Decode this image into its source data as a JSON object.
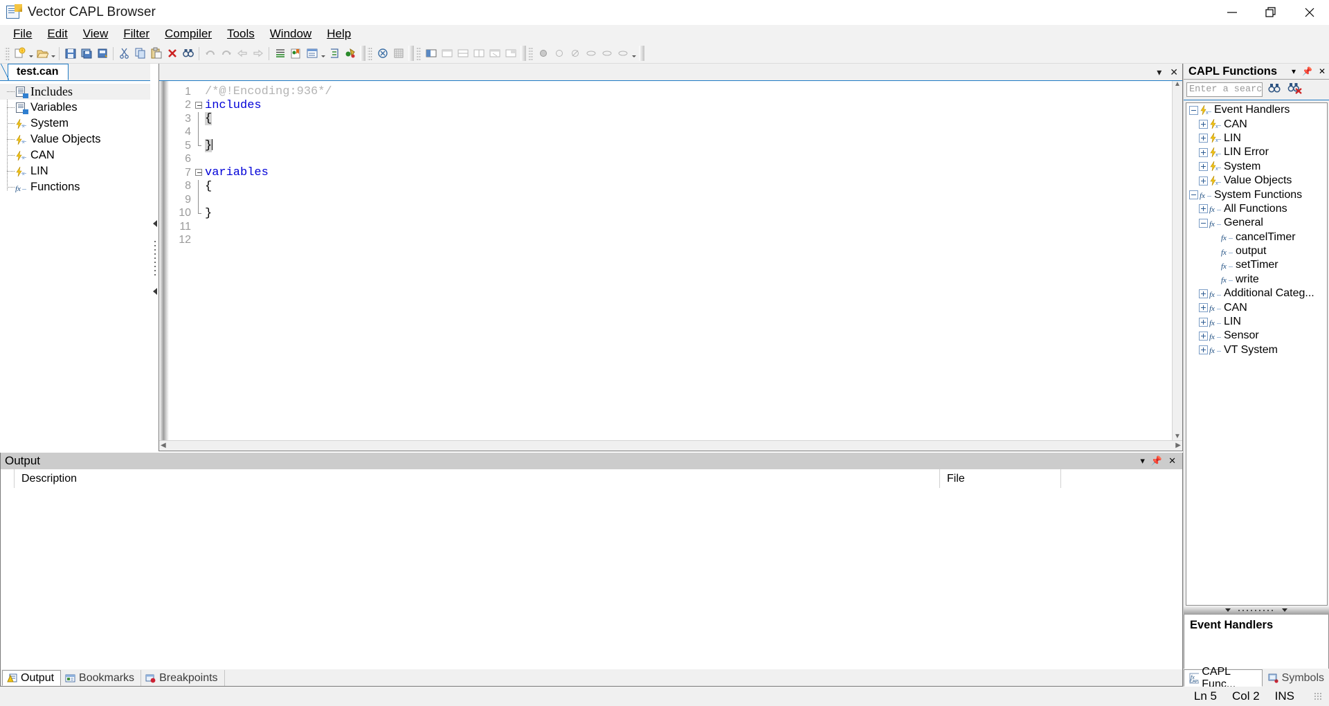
{
  "window": {
    "title": "Vector CAPL Browser",
    "icon": "capl-document-icon",
    "controls": {
      "minimize": "—",
      "restore": "❐",
      "close": "✕"
    }
  },
  "menubar": {
    "items": [
      {
        "label": "File",
        "accel": "F"
      },
      {
        "label": "Edit",
        "accel": "E"
      },
      {
        "label": "View",
        "accel": "V"
      },
      {
        "label": "Filter",
        "accel": "i"
      },
      {
        "label": "Compiler",
        "accel": "C"
      },
      {
        "label": "Tools",
        "accel": "T"
      },
      {
        "label": "Window",
        "accel": "W"
      },
      {
        "label": "Help",
        "accel": "H"
      }
    ]
  },
  "toolbar": {
    "groups": [
      {
        "buttons": [
          "new-file-icon",
          "dropdown-arrow",
          "open-file-icon",
          "dropdown-arrow"
        ]
      },
      {
        "buttons": [
          "save-icon",
          "save-all-icon",
          "save-copy-icon"
        ]
      },
      {
        "buttons": [
          "cut-icon",
          "copy-icon",
          "paste-icon",
          "delete-icon",
          "find-icon"
        ]
      },
      {
        "buttons": [
          "undo-icon",
          "redo-icon",
          "navigate-back-icon",
          "navigate-forward-icon"
        ]
      },
      {
        "buttons": [
          "indent-icon",
          "bookmark-icon",
          "comment-icon",
          "dropdown-arrow",
          "uncomment-icon",
          "compile-icon"
        ]
      },
      {
        "buttons": [
          "build-icon",
          "debug-icon"
        ]
      },
      {
        "buttons": [
          "window-tile-icon",
          "window-cascade-icon",
          "window-h-icon",
          "window-v-icon",
          "window-close-icon",
          "window-arrange-icon"
        ]
      },
      {
        "buttons": [
          "breakpoint-icon",
          "breakpoint-disable-icon",
          "breakpoint-clear-icon",
          "step-icon",
          "run-icon",
          "stop-icon",
          "dropdown-arrow"
        ]
      }
    ]
  },
  "editor_tab_strip": {
    "buttons": [
      "chevron-down-icon",
      "close-icon"
    ]
  },
  "project_tree": {
    "tab_label": "test.can",
    "items": [
      {
        "label": "Includes",
        "icon": "includes-file-icon",
        "selected": true
      },
      {
        "label": "Variables",
        "icon": "variables-file-icon",
        "selected": false
      },
      {
        "label": "System",
        "icon": "event-bolt-icon",
        "selected": false
      },
      {
        "label": "Value Objects",
        "icon": "event-bolt-icon",
        "selected": false
      },
      {
        "label": "CAN",
        "icon": "event-bolt-icon",
        "selected": false
      },
      {
        "label": "LIN",
        "icon": "event-bolt-icon",
        "selected": false
      },
      {
        "label": "Functions",
        "icon": "functions-icon",
        "selected": false
      }
    ]
  },
  "code": {
    "lines": [
      {
        "no": "1",
        "fold": "none",
        "tokens": [
          {
            "t": "/*@!Encoding:936*/",
            "cls": "c-comment"
          }
        ]
      },
      {
        "no": "2",
        "fold": "minus",
        "tokens": [
          {
            "t": "includes",
            "cls": "c-kw"
          }
        ]
      },
      {
        "no": "3",
        "fold": "line",
        "tokens": [
          {
            "t": "{",
            "cls": "c-brace"
          }
        ]
      },
      {
        "no": "4",
        "fold": "line",
        "tokens": []
      },
      {
        "no": "5",
        "fold": "end",
        "tokens": [
          {
            "t": "}",
            "cls": "c-brace"
          },
          {
            "t": "",
            "cls": "caret"
          }
        ]
      },
      {
        "no": "6",
        "fold": "none",
        "tokens": []
      },
      {
        "no": "7",
        "fold": "minus",
        "tokens": [
          {
            "t": "variables",
            "cls": "c-kw"
          }
        ]
      },
      {
        "no": "8",
        "fold": "line",
        "tokens": [
          {
            "t": "{",
            "cls": ""
          }
        ]
      },
      {
        "no": "9",
        "fold": "line",
        "tokens": []
      },
      {
        "no": "10",
        "fold": "end",
        "tokens": [
          {
            "t": "}",
            "cls": ""
          }
        ]
      },
      {
        "no": "11",
        "fold": "none",
        "tokens": []
      },
      {
        "no": "12",
        "fold": "none",
        "tokens": []
      }
    ]
  },
  "output_panel": {
    "title": "Output",
    "title_buttons": [
      "chevron-down-icon",
      "pin-icon",
      "close-icon"
    ],
    "columns": [
      "",
      "Description",
      "File",
      ""
    ],
    "rows": [],
    "tabs": [
      {
        "label": "Output",
        "icon": "output-warning-icon",
        "active": true
      },
      {
        "label": "Bookmarks",
        "icon": "bookmarks-icon",
        "active": false
      },
      {
        "label": "Breakpoints",
        "icon": "breakpoints-icon",
        "active": false
      }
    ]
  },
  "capl_functions": {
    "title": "CAPL Functions",
    "title_buttons": [
      "chevron-down-icon",
      "pin-icon",
      "close-icon"
    ],
    "search": {
      "value": "",
      "placeholder": "Enter a search",
      "chevron": "chevron-down-icon"
    },
    "search_buttons": [
      "find-icon",
      "find-clear-icon"
    ],
    "tree": [
      {
        "label": "Event Handlers",
        "depth": 0,
        "toggle": "minus",
        "icon": "event-bolt-icon"
      },
      {
        "label": "CAN",
        "depth": 1,
        "toggle": "plus",
        "icon": "event-bolt-icon"
      },
      {
        "label": "LIN",
        "depth": 1,
        "toggle": "plus",
        "icon": "event-bolt-icon"
      },
      {
        "label": "LIN Error",
        "depth": 1,
        "toggle": "plus",
        "icon": "event-bolt-icon"
      },
      {
        "label": "System",
        "depth": 1,
        "toggle": "plus",
        "icon": "event-bolt-icon"
      },
      {
        "label": "Value Objects",
        "depth": 1,
        "toggle": "plus",
        "icon": "event-bolt-icon"
      },
      {
        "label": "System Functions",
        "depth": 0,
        "toggle": "minus",
        "icon": "fx-icon"
      },
      {
        "label": "All Functions",
        "depth": 1,
        "toggle": "plus",
        "icon": "fx-icon"
      },
      {
        "label": "General",
        "depth": 1,
        "toggle": "minus",
        "icon": "fx-icon"
      },
      {
        "label": "cancelTimer",
        "depth": 2,
        "toggle": "none",
        "icon": "fx-icon"
      },
      {
        "label": "output",
        "depth": 2,
        "toggle": "none",
        "icon": "fx-icon"
      },
      {
        "label": "setTimer",
        "depth": 2,
        "toggle": "none",
        "icon": "fx-icon"
      },
      {
        "label": "write",
        "depth": 2,
        "toggle": "none",
        "icon": "fx-icon"
      },
      {
        "label": "Additional Categ...",
        "depth": 1,
        "toggle": "plus",
        "icon": "fx-icon"
      },
      {
        "label": "CAN",
        "depth": 1,
        "toggle": "plus",
        "icon": "fx-icon"
      },
      {
        "label": "LIN",
        "depth": 1,
        "toggle": "plus",
        "icon": "fx-icon"
      },
      {
        "label": "Sensor",
        "depth": 1,
        "toggle": "plus",
        "icon": "fx-icon"
      },
      {
        "label": "VT System",
        "depth": 1,
        "toggle": "plus",
        "icon": "fx-icon"
      }
    ],
    "description": "Event Handlers",
    "tabs": [
      {
        "label": "CAPL Func...",
        "icon": "capl-fx-icon",
        "active": true
      },
      {
        "label": "Symbols",
        "icon": "symbols-icon",
        "active": false
      }
    ]
  },
  "statusbar": {
    "line": "Ln 5",
    "column": "Col 2",
    "mode": "INS"
  },
  "colors": {
    "accent": "#1e7ac4",
    "keyword": "#0000d8",
    "comment": "#b4b4b4",
    "panel_title": "#cccccc",
    "chrome": "#f0f2f2"
  }
}
